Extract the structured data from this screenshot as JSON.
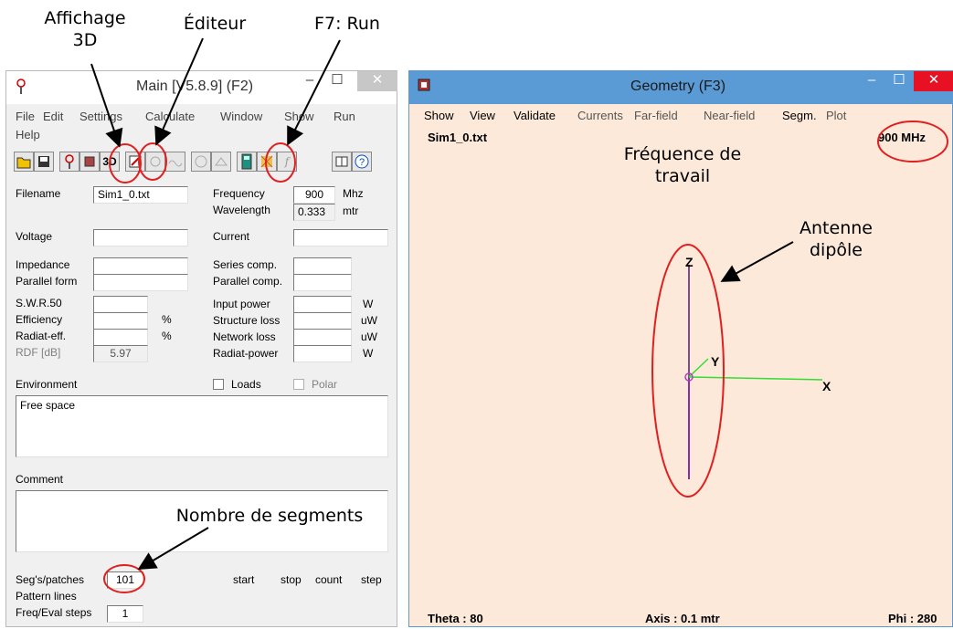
{
  "annotations": {
    "affichage_3d": "Affichage\n3D",
    "editeur": "Éditeur",
    "run": "F7: Run",
    "frequence": "Fréquence de\ntravail",
    "antenne": "Antenne\ndipôle",
    "segments": "Nombre de segments"
  },
  "main_window": {
    "title": "Main [V5.8.9]  (F2)",
    "menu": [
      "File",
      "Edit",
      "Settings",
      "Calculate",
      "Window",
      "Show",
      "Run",
      "Help"
    ],
    "toolbar_icons": [
      "open-folder-icon",
      "save-icon",
      "pattern-icon",
      "cube-icon",
      "3d-view-icon",
      "editor-icon",
      "gear-icon",
      "wave-icon",
      "globe-icon",
      "network-icon",
      "calculator-run-icon",
      "mesh-icon",
      "function-icon",
      "book-icon",
      "help-icon"
    ],
    "toolbar_3d_label": "3D",
    "toolbar_fn_label": "f"
  },
  "main_fields": {
    "filename_label": "Filename",
    "filename_value": "Sim1_0.txt",
    "frequency_label": "Frequency",
    "frequency_value": "900",
    "frequency_unit": "Mhz",
    "wavelength_label": "Wavelength",
    "wavelength_value": "0.333",
    "wavelength_unit": "mtr",
    "voltage_label": "Voltage",
    "voltage_value": "",
    "current_label": "Current",
    "current_value": "",
    "impedance_label": "Impedance",
    "impedance_value": "",
    "series_comp_label": "Series comp.",
    "series_comp_value": "",
    "parallel_form_label": "Parallel form",
    "parallel_form_value": "",
    "parallel_comp_label": "Parallel comp.",
    "parallel_comp_value": "",
    "swr_label": "S.W.R.50",
    "swr_value": "",
    "input_power_label": "Input power",
    "input_power_value": "",
    "input_power_unit": "W",
    "efficiency_label": "Efficiency",
    "efficiency_value": "",
    "efficiency_unit": "%",
    "structure_loss_label": "Structure loss",
    "structure_loss_value": "",
    "structure_loss_unit": "uW",
    "radiat_eff_label": "Radiat-eff.",
    "radiat_eff_value": "",
    "radiat_eff_unit": "%",
    "network_loss_label": "Network loss",
    "network_loss_value": "",
    "network_loss_unit": "uW",
    "rdf_label": "RDF [dB]",
    "rdf_value": "5.97",
    "radiat_power_label": "Radiat-power",
    "radiat_power_value": "",
    "radiat_power_unit": "W",
    "environment_label": "Environment",
    "loads_label": "Loads",
    "polar_label": "Polar",
    "environment_value": "Free space",
    "comment_label": "Comment",
    "comment_value": "",
    "segs_label": "Seg's/patches",
    "segs_value": "101",
    "pattern_lines_label": "Pattern lines",
    "freq_eval_label": "Freq/Eval steps",
    "freq_eval_value": "1",
    "col_start": "start",
    "col_stop": "stop",
    "col_count": "count",
    "col_step": "step"
  },
  "geometry_window": {
    "title": "Geometry   (F3)",
    "menu": [
      "Show",
      "View",
      "Validate",
      "Currents",
      "Far-field",
      "Near-field",
      "Segm.",
      "Plot"
    ],
    "filename": "Sim1_0.txt",
    "frequency": "900 MHz",
    "theta": "Theta : 80",
    "axis": "Axis : 0.1 mtr",
    "phi": "Phi : 280",
    "axis_x": "X",
    "axis_y": "Y",
    "axis_z": "Z"
  },
  "window_controls": {
    "minimize": "–",
    "maximize": "☐",
    "close": "✕"
  },
  "colors": {
    "geometry_bg": "#fde9d9",
    "geometry_title": "#5b9bd5",
    "annotation_circle": "#e02020",
    "axis_green": "#33dd33",
    "dipole_purple": "#8b2f9f"
  }
}
